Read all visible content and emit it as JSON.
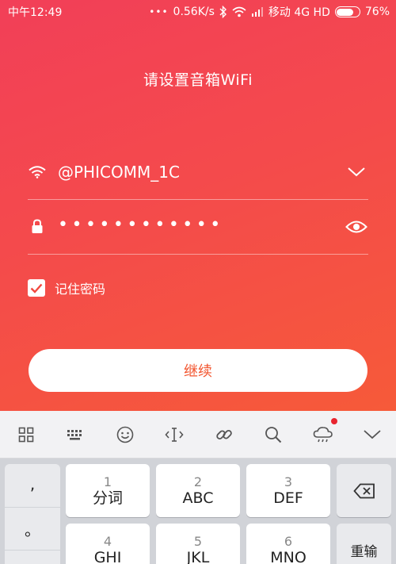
{
  "status_bar": {
    "carrier_time": "中午12:49",
    "dots": "•••",
    "speed": "0.56K/s",
    "network": "移动 4G HD",
    "battery": "76%",
    "battery_level": 0.76
  },
  "page": {
    "title": "请设置音箱WiFi"
  },
  "wifi": {
    "ssid": "@PHICOMM_1C"
  },
  "password": {
    "masked": "••••••••••••"
  },
  "remember": {
    "label": "记住密码",
    "checked": true
  },
  "continue_button": {
    "label": "继续"
  },
  "keyboard": {
    "punct": [
      ",",
      "。",
      "?"
    ],
    "keys": [
      {
        "num": "1",
        "letters": "分词"
      },
      {
        "num": "2",
        "letters": "ABC"
      },
      {
        "num": "3",
        "letters": "DEF"
      },
      {
        "num": "4",
        "letters": "GHI"
      },
      {
        "num": "5",
        "letters": "JKL"
      },
      {
        "num": "6",
        "letters": "MNO"
      }
    ],
    "reinput_label": "重输"
  },
  "colors": {
    "gradient_start": "#f23f58",
    "gradient_end": "#f65a39",
    "button_text": "#f2542e"
  }
}
